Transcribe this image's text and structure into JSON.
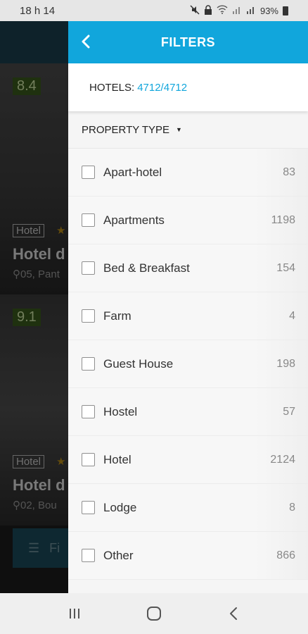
{
  "status_bar": {
    "time": "18 h 14",
    "battery": "93%",
    "icons": [
      "mute-icon",
      "lock-icon",
      "wifi-icon",
      "signal-icon",
      "signal-icon",
      "battery-icon"
    ]
  },
  "background_list": {
    "cards": [
      {
        "score": "8.4",
        "tag": "Hotel",
        "name": "Hotel d",
        "address": "05, Pant"
      },
      {
        "score": "9.1",
        "tag": "Hotel",
        "name": "Hotel d",
        "address": "02, Bou"
      }
    ],
    "filter_button_label": "Fi"
  },
  "filters": {
    "title": "FILTERS",
    "hotels_label": "HOTELS:",
    "hotels_count": "4712/4712",
    "section_title": "PROPERTY TYPE",
    "items": [
      {
        "label": "Apart-hotel",
        "count": "83"
      },
      {
        "label": "Apartments",
        "count": "1198"
      },
      {
        "label": "Bed & Breakfast",
        "count": "154"
      },
      {
        "label": "Farm",
        "count": "4"
      },
      {
        "label": "Guest House",
        "count": "198"
      },
      {
        "label": "Hostel",
        "count": "57"
      },
      {
        "label": "Hotel",
        "count": "2124"
      },
      {
        "label": "Lodge",
        "count": "8"
      },
      {
        "label": "Other",
        "count": "866"
      }
    ]
  },
  "colors": {
    "accent": "#11a6dc",
    "score_badge": "#3a5a1c"
  },
  "nav_bar": {
    "icons": [
      "recent-apps-icon",
      "home-icon",
      "back-nav-icon"
    ]
  }
}
